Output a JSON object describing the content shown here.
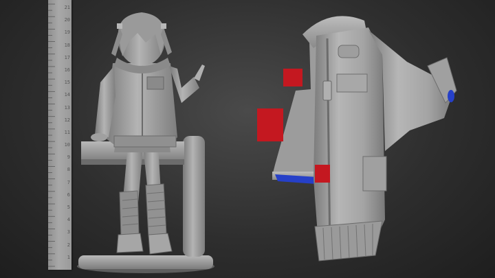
{
  "scene": {
    "background_color": "#2b2b2b",
    "ruler_labels": [
      "21",
      "20",
      "19",
      "18",
      "17",
      "16",
      "15",
      "14",
      "13",
      "12",
      "11",
      "10",
      "9",
      "8",
      "7",
      "6",
      "5",
      "4",
      "3",
      "2",
      "1"
    ],
    "objects": [
      {
        "name": "sculpted-figure",
        "description_color": "#9c9c9c"
      },
      {
        "name": "jacket-part",
        "description_color": "#a3a3a3"
      }
    ],
    "colors": {
      "clay": "#a0a0a0",
      "clay_shadow": "#6e6e6e",
      "clay_highlight": "#c8c8c8",
      "peg_red": "#c41820",
      "inner_blue": "#2640c8"
    }
  }
}
